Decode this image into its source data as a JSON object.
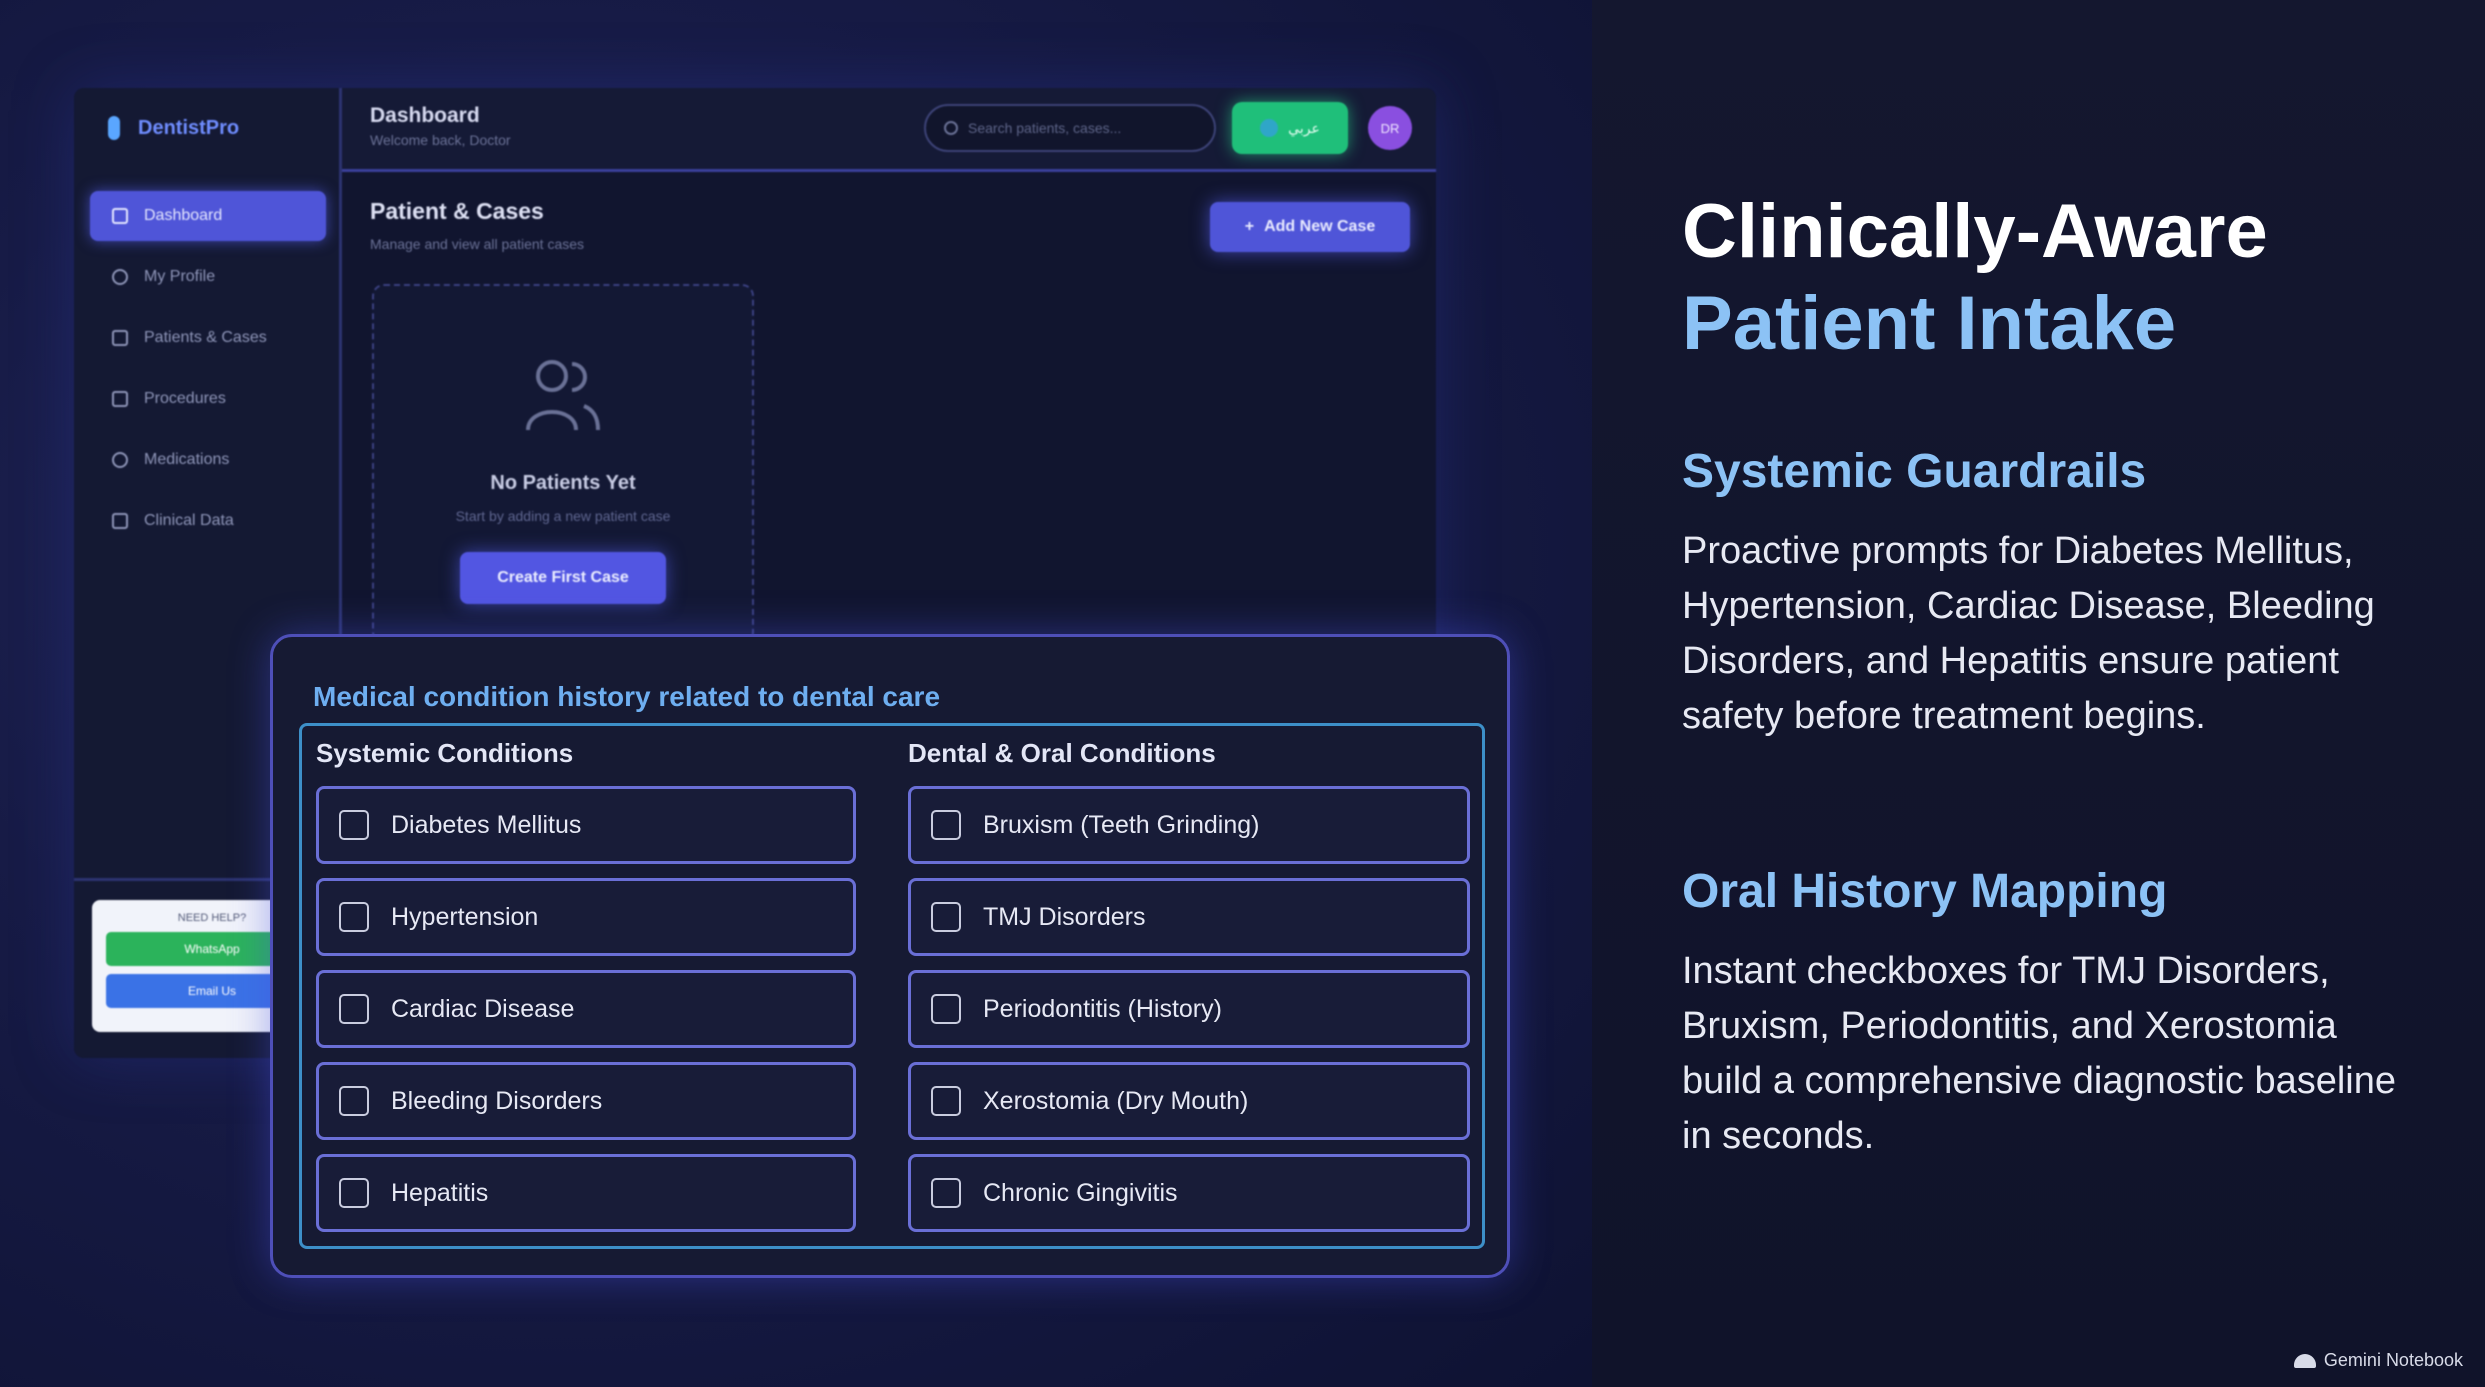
{
  "dashboard": {
    "brand": "DentistPro",
    "nav": [
      {
        "label": "Dashboard",
        "icon": "grid-icon",
        "active": true
      },
      {
        "label": "My Profile",
        "icon": "user-icon",
        "active": false
      },
      {
        "label": "Patients & Cases",
        "icon": "document-icon",
        "active": false
      },
      {
        "label": "Procedures",
        "icon": "checklist-icon",
        "active": false
      },
      {
        "label": "Medications",
        "icon": "pill-icon",
        "active": false
      },
      {
        "label": "Clinical Data",
        "icon": "book-icon",
        "active": false
      }
    ],
    "help": {
      "title": "NEED HELP?",
      "whatsapp": "WhatsApp",
      "email": "Email Us"
    },
    "topbar": {
      "title": "Dashboard",
      "subtitle": "Welcome back, Doctor",
      "search_placeholder": "Search patients, cases...",
      "lang_label": "عربي",
      "avatar": "DR"
    },
    "main": {
      "title": "Patient & Cases",
      "subtitle": "Manage and view all patient cases",
      "add_button": "Add New Case",
      "empty_title": "No Patients Yet",
      "empty_sub": "Start by adding a new patient case",
      "create_button": "Create First Case"
    }
  },
  "panel": {
    "title": "Medical condition history related to dental care",
    "systemic_title": "Systemic Conditions",
    "dental_title": "Dental & Oral Conditions",
    "systemic": [
      "Diabetes Mellitus",
      "Hypertension",
      "Cardiac Disease",
      "Bleeding Disorders",
      "Hepatitis"
    ],
    "dental": [
      "Bruxism (Teeth Grinding)",
      "TMJ Disorders",
      "Periodontitis (History)",
      "Xerostomia (Dry Mouth)",
      "Chronic Gingivitis"
    ]
  },
  "copy": {
    "headline_1": "Clinically-Aware",
    "headline_2": "Patient Intake",
    "section1_title": "Systemic Guardrails",
    "section1_body": "Proactive prompts for Diabetes Mellitus, Hypertension, Cardiac Disease, Bleeding Disorders, and Hepatitis ensure patient safety before treatment begins.",
    "section2_title": "Oral History Mapping",
    "section2_body": "Instant checkboxes for TMJ Disorders, Bruxism, Periodontitis, and Xerostomia build a comprehensive diagnostic baseline in seconds."
  },
  "footer": {
    "brand": "Gemini Notebook"
  },
  "colors": {
    "accent": "#4f55d8",
    "heading_blue": "#8cc2f5",
    "panel_title": "#6eaef0",
    "success": "#1fbf7a"
  }
}
